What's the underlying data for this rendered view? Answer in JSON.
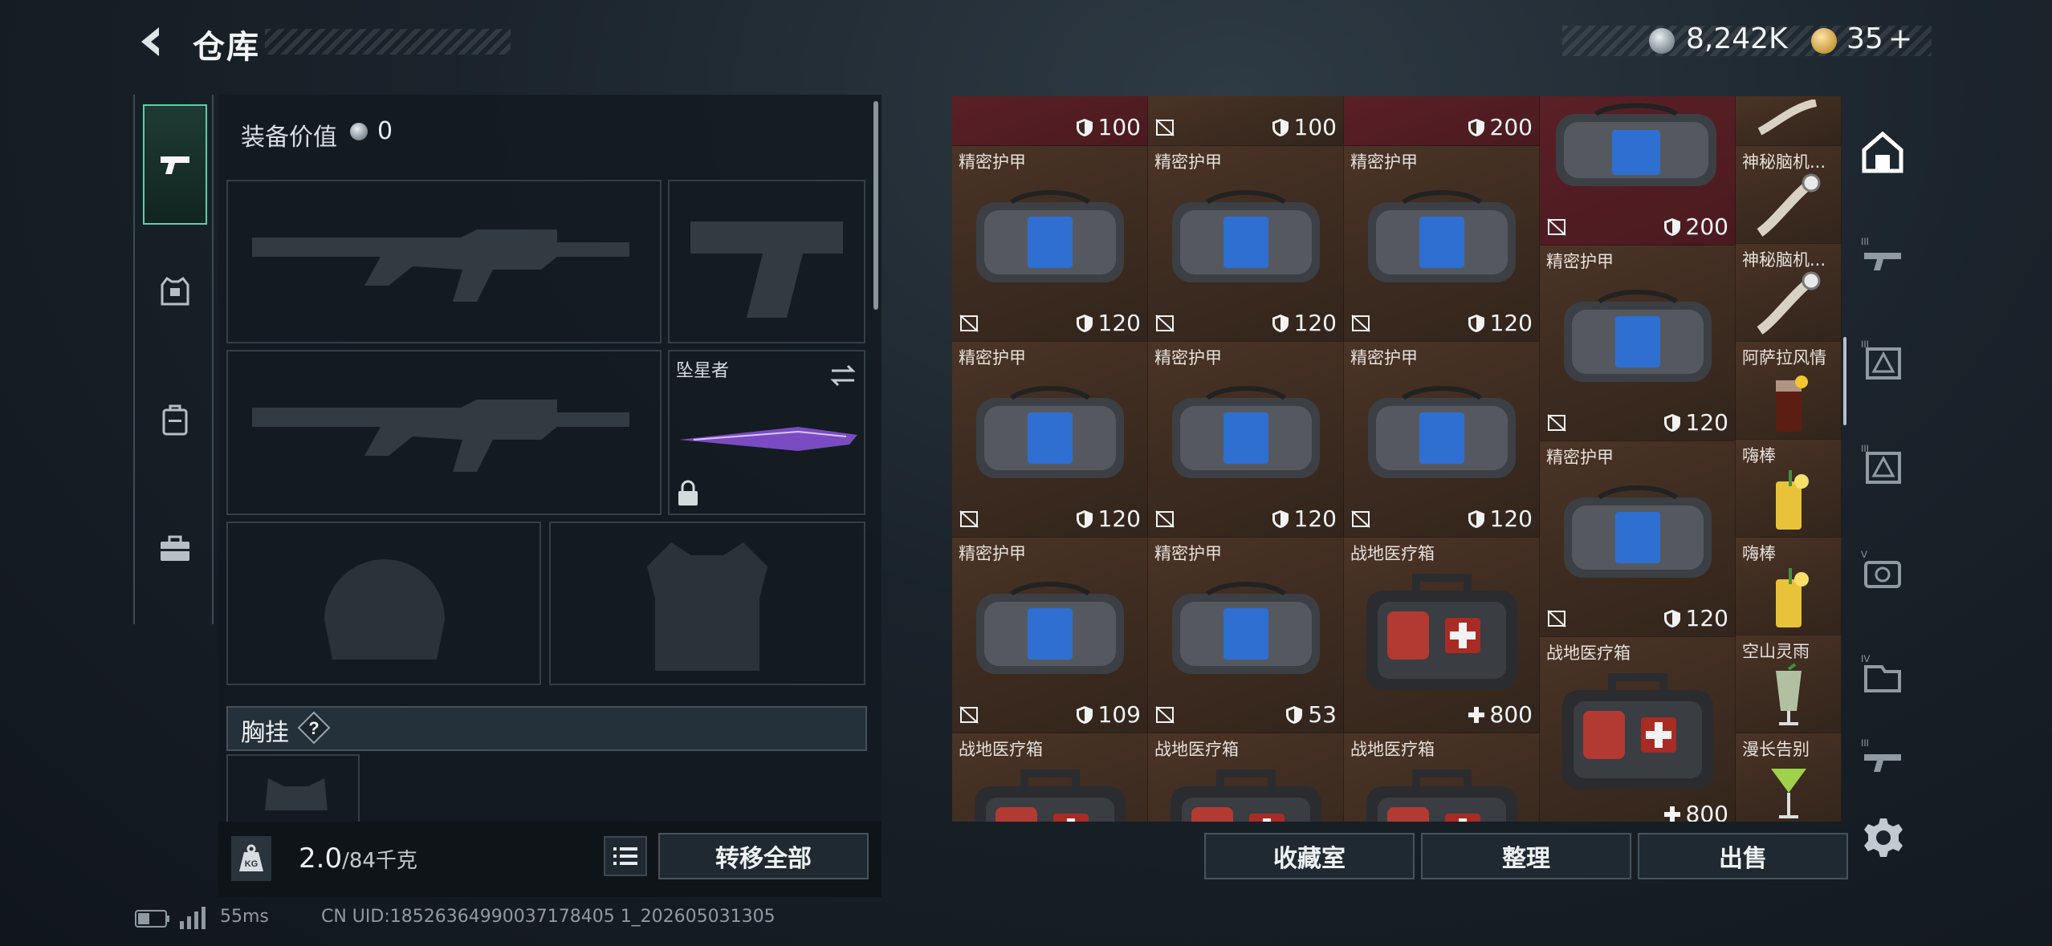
{
  "header": {
    "title": "仓库",
    "silver_amount": "8,242K",
    "gold_amount": "35",
    "gold_plus": "+"
  },
  "side_tabs": [
    {
      "name": "weapons",
      "icon": "pistol-icon",
      "active": true
    },
    {
      "name": "armor",
      "icon": "vest-icon",
      "active": false
    },
    {
      "name": "backpack",
      "icon": "backpack-icon",
      "active": false
    },
    {
      "name": "medkit",
      "icon": "toolbox-icon",
      "active": false
    }
  ],
  "loadout": {
    "equip_value_label": "装备价值",
    "equip_value": "0",
    "melee_name": "坠星者",
    "chest_label": "胸挂",
    "help": "?",
    "weight_current": "2.0",
    "weight_max": "/84千克",
    "weight_badge": "KG",
    "transfer_all": "转移全部"
  },
  "inventory": {
    "top_partial": [
      {
        "val": "100",
        "icon": "shield-icon"
      },
      {
        "val": "100",
        "icon": "shield-icon"
      },
      {
        "val": "200",
        "icon": "shield-icon"
      }
    ],
    "rows": [
      [
        {
          "name": "精密护甲",
          "val": "120",
          "icon": "shield-icon"
        },
        {
          "name": "精密护甲",
          "val": "120",
          "icon": "shield-icon"
        },
        {
          "name": "精密护甲",
          "val": "120",
          "icon": "shield-icon"
        }
      ],
      [
        {
          "name": "精密护甲",
          "val": "120",
          "icon": "shield-icon"
        },
        {
          "name": "精密护甲",
          "val": "120",
          "icon": "shield-icon"
        },
        {
          "name": "精密护甲",
          "val": "120",
          "icon": "shield-icon"
        }
      ],
      [
        {
          "name": "精密护甲",
          "val": "109",
          "icon": "shield-icon"
        },
        {
          "name": "精密护甲",
          "val": "53",
          "icon": "shield-icon"
        },
        {
          "name": "战地医疗箱",
          "val": "800",
          "icon": "plus-icon"
        }
      ],
      [
        {
          "name": "战地医疗箱",
          "val": "",
          "icon": ""
        },
        {
          "name": "战地医疗箱",
          "val": "",
          "icon": ""
        },
        {
          "name": "战地医疗箱",
          "val": "",
          "icon": ""
        }
      ]
    ],
    "col4": [
      {
        "name": "",
        "val": "200",
        "icon": "shield-icon"
      },
      {
        "name": "精密护甲",
        "val": "120",
        "icon": "shield-icon"
      },
      {
        "name": "精密护甲",
        "val": "120",
        "icon": "shield-icon"
      },
      {
        "name": "战地医疗箱",
        "val": "800",
        "icon": "plus-icon"
      }
    ],
    "col5": [
      {
        "name": ""
      },
      {
        "name": "神秘脑机..."
      },
      {
        "name": "神秘脑机..."
      },
      {
        "name": "阿萨拉风情"
      },
      {
        "name": "嗨棒"
      },
      {
        "name": "嗨棒"
      },
      {
        "name": "空山灵雨"
      },
      {
        "name": "漫长告别"
      }
    ],
    "buttons": {
      "collection": "收藏室",
      "sort": "整理",
      "sell": "出售"
    }
  },
  "rail": [
    {
      "icon": "warehouse-icon"
    },
    {
      "icon": "tier-3-gun-icon"
    },
    {
      "icon": "tier-3-triangle-icon"
    },
    {
      "icon": "tier-3-triangle-icon"
    },
    {
      "icon": "tier-5-camera-icon"
    },
    {
      "icon": "tier-4-box-icon"
    },
    {
      "icon": "tier-3-gun-icon"
    }
  ],
  "status": {
    "ping": "55ms",
    "uid": "CN UID:18526364990037178405 1_202605031305"
  },
  "colors": {
    "accent_green": "#5ecfa3",
    "cell_brown": "#3b2a1f",
    "cell_red": "#4a1a1f"
  }
}
